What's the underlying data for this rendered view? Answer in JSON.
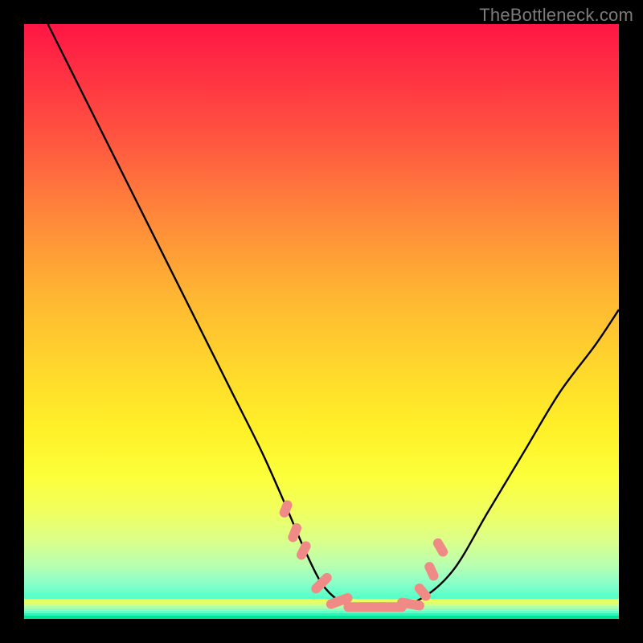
{
  "watermark": "TheBottleneck.com",
  "chart_data": {
    "type": "line",
    "title": "",
    "xlabel": "",
    "ylabel": "",
    "xlim": [
      0,
      100
    ],
    "ylim": [
      0,
      100
    ],
    "grid": false,
    "legend": false,
    "series": [
      {
        "name": "curve",
        "x": [
          4,
          10,
          15,
          20,
          25,
          30,
          35,
          40,
          44,
          47,
          50,
          53,
          56,
          60,
          66,
          72,
          78,
          84,
          90,
          96,
          100
        ],
        "values": [
          100,
          88,
          78,
          68,
          58,
          48,
          38,
          28,
          19,
          12,
          6,
          3,
          2,
          2,
          3,
          8,
          18,
          28,
          38,
          46,
          52
        ]
      }
    ],
    "markers": {
      "name": "pink-dashes",
      "color": "#f08a86",
      "x": [
        44.0,
        45.5,
        47.0,
        50.0,
        53.0,
        56.0,
        59.0,
        62.0,
        65.0,
        67.0,
        68.5,
        70.0
      ],
      "values": [
        18.5,
        14.5,
        11.5,
        6.0,
        3.0,
        2.0,
        2.0,
        2.0,
        2.5,
        4.5,
        8.0,
        12.0
      ],
      "length": [
        3.0,
        3.3,
        3.3,
        4.2,
        4.6,
        4.6,
        4.6,
        4.6,
        4.6,
        3.3,
        3.3,
        3.3
      ],
      "angle": [
        -68,
        -68,
        -63,
        -45,
        -20,
        0,
        0,
        0,
        10,
        50,
        65,
        60
      ]
    },
    "bottom_bands": {
      "heights": [
        3,
        3,
        3,
        3,
        3,
        3,
        3,
        4
      ],
      "colors": [
        "#f2ff4e",
        "#e2ff6a",
        "#ccff8c",
        "#b0ffac",
        "#8cffc0",
        "#60ffc8",
        "#2cf5b8",
        "#00e59a"
      ]
    }
  }
}
